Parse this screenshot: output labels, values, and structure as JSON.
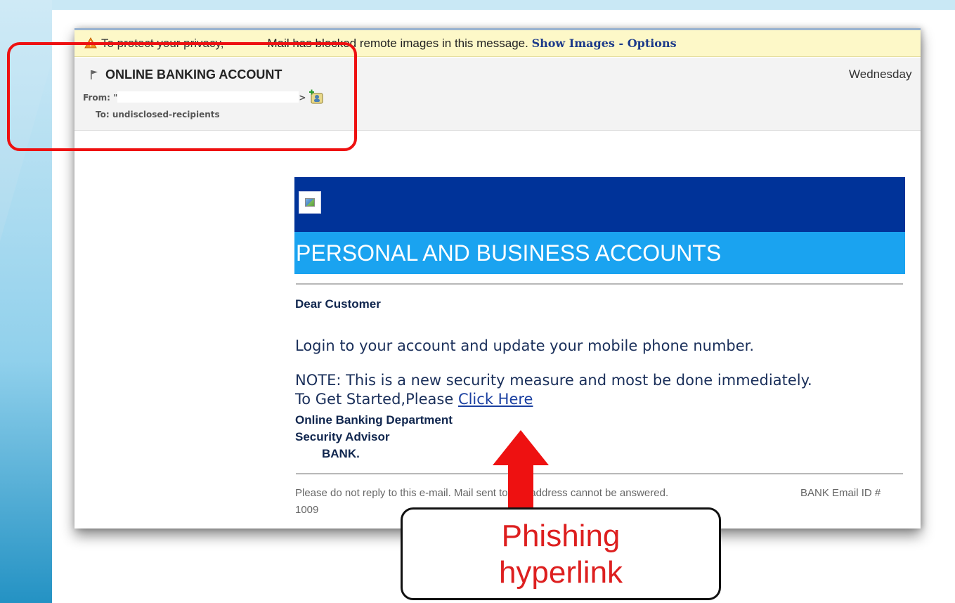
{
  "privacy_bar": {
    "text_before": "To protect your privacy,",
    "text_after": "Mail has blocked remote images in this message.",
    "show_images_link": "Show Images",
    "separator": " - ",
    "options_link": "Options"
  },
  "header": {
    "subject": "ONLINE BANKING ACCOUNT",
    "date": "Wednesday",
    "from_label": "From:",
    "from_quote": "\"",
    "from_end": ">",
    "to_label": "To:",
    "to_value": "undisclosed-recipients"
  },
  "body": {
    "banner_title": "PERSONAL AND BUSINESS ACCOUNTS",
    "greeting": "Dear Customer",
    "line1": "Login to your account and update your mobile phone number.",
    "line2": "NOTE: This is a new security measure and most be done immediately.",
    "line3_prefix": "To Get Started,Please ",
    "line3_link": "Click Here",
    "sig1": "Online Banking Department",
    "sig2": "Security Advisor",
    "sig3": "BANK.",
    "footer": "Please do not reply to this e-mail. Mail sent to this address cannot be answered.",
    "footer_id": "BANK Email ID #",
    "footer_num": "1009"
  },
  "annotation": {
    "callout_line1": "Phishing",
    "callout_line2": "hyperlink",
    "box_color": "#ee1111",
    "arrow_color": "#ee1111"
  },
  "colors": {
    "banner_dark": "#003399",
    "banner_light": "#1aa3f0",
    "privacy_bg": "#fdf8c8",
    "link": "#1a3fa0"
  },
  "icons": [
    "warning-icon",
    "flag-icon",
    "add-contact-icon",
    "broken-image-icon"
  ]
}
